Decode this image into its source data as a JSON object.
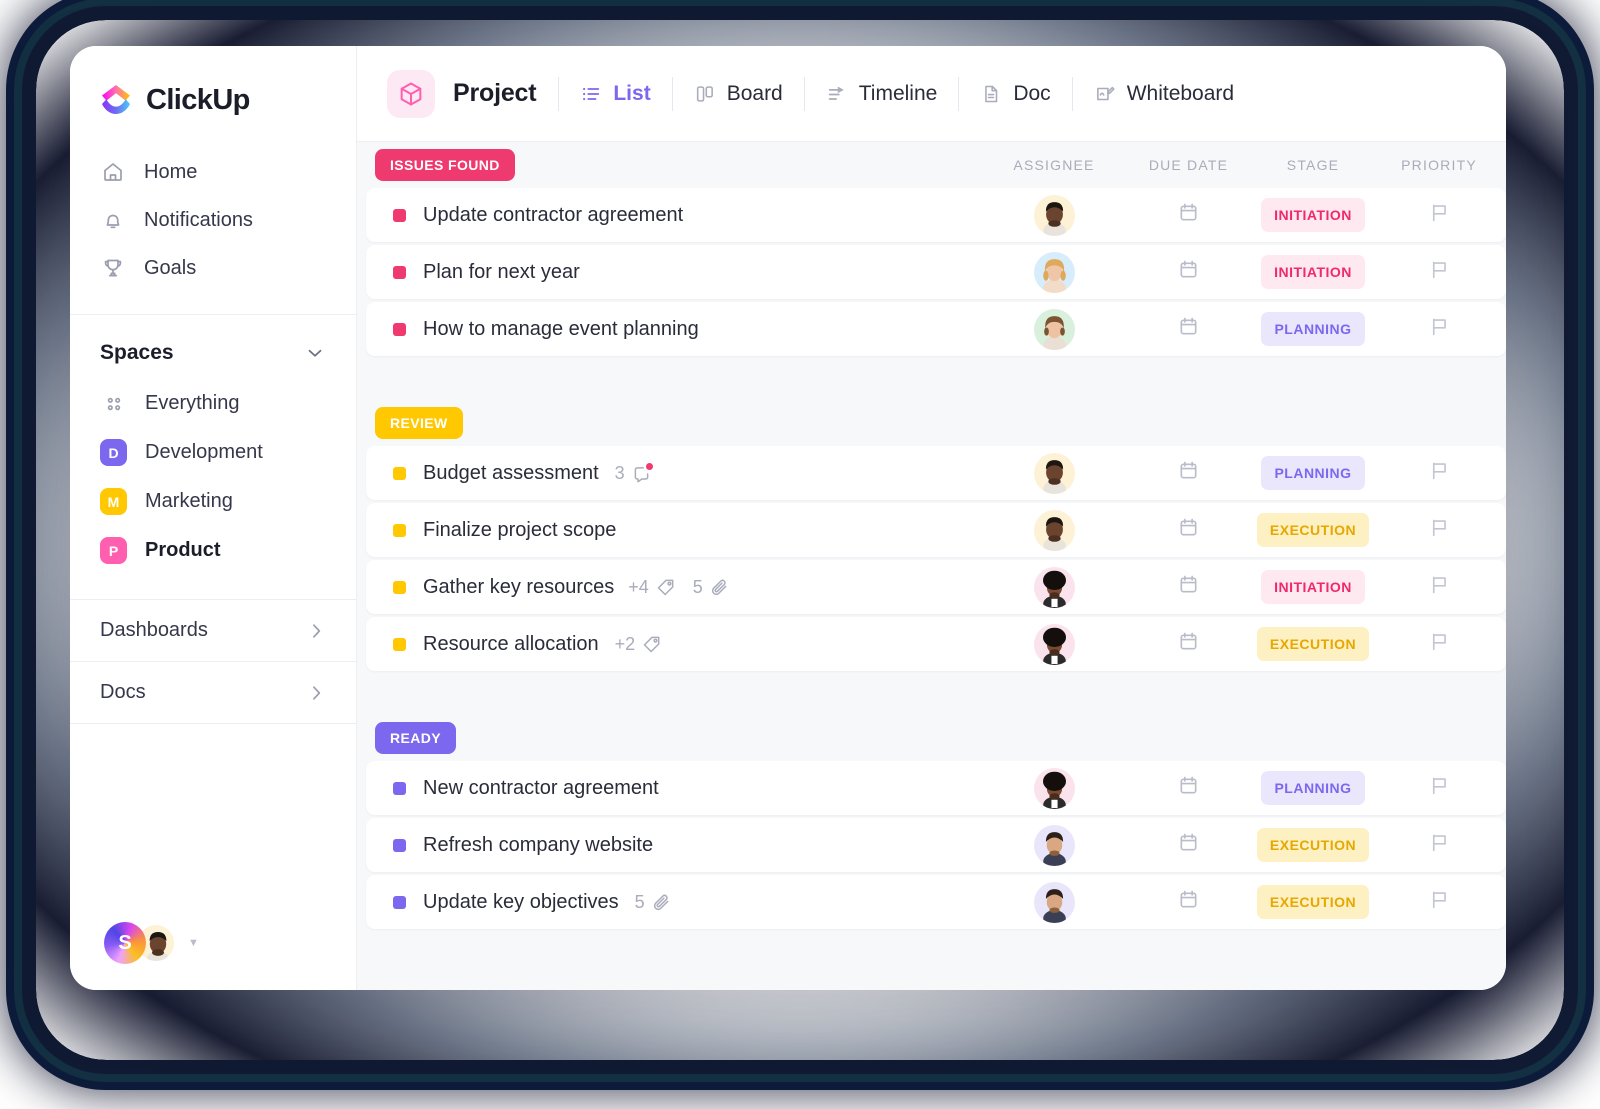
{
  "brand": {
    "name": "ClickUp",
    "logo_icon": "clickup-logo-icon"
  },
  "sidebar": {
    "nav": [
      {
        "label": "Home",
        "icon": "home-icon"
      },
      {
        "label": "Notifications",
        "icon": "bell-icon"
      },
      {
        "label": "Goals",
        "icon": "trophy-icon"
      }
    ],
    "spaces": {
      "title": "Spaces",
      "chevron_icon": "chevron-down-icon",
      "items": [
        {
          "label": "Everything",
          "icon": "grid-dots-icon",
          "chip": null,
          "color": null,
          "active": false
        },
        {
          "label": "Development",
          "chip": "D",
          "color": "#7b68ee",
          "active": false
        },
        {
          "label": "Marketing",
          "chip": "M",
          "color": "#ffc800",
          "active": false
        },
        {
          "label": "Product",
          "chip": "P",
          "color": "#ff5fae",
          "active": true
        }
      ]
    },
    "sections": [
      {
        "label": "Dashboards",
        "icon": "chevron-right-icon"
      },
      {
        "label": "Docs",
        "icon": "chevron-right-icon"
      }
    ],
    "footer": {
      "workspace_initial": "S",
      "avatar_icon": "user-avatar",
      "caret_icon": "caret-down-icon"
    }
  },
  "header": {
    "project_icon": "cube-icon",
    "title": "Project",
    "tabs": [
      {
        "label": "List",
        "icon": "list-icon",
        "active": true
      },
      {
        "label": "Board",
        "icon": "board-icon",
        "active": false
      },
      {
        "label": "Timeline",
        "icon": "timeline-icon",
        "active": false
      },
      {
        "label": "Doc",
        "icon": "doc-icon",
        "active": false
      },
      {
        "label": "Whiteboard",
        "icon": "whiteboard-icon",
        "active": false
      }
    ]
  },
  "columns": [
    "ASSIGNEE",
    "DUE DATE",
    "STAGE",
    "PRIORITY"
  ],
  "stage_colors": {
    "INITIATION": {
      "bg": "#ffe9f0",
      "fg": "#f0296b"
    },
    "PLANNING": {
      "bg": "#eae7fd",
      "fg": "#7b68ee"
    },
    "EXECUTION": {
      "bg": "#fdf0c2",
      "fg": "#e6a700"
    }
  },
  "groups": [
    {
      "label": "ISSUES FOUND",
      "color": "#ef3a6f",
      "bullet": "#ef3a6f",
      "show_columns": true,
      "tasks": [
        {
          "name": "Update contractor agreement",
          "comments": null,
          "tags": null,
          "attachments": null,
          "avatar": {
            "bg": "#fdf1d6",
            "skin": "#6b4430",
            "hair": "#1d1712",
            "shirt": "#e8e4dc"
          },
          "due_icon": "calendar-icon",
          "stage": "INITIATION",
          "priority_icon": "flag-icon"
        },
        {
          "name": "Plan for next year",
          "comments": null,
          "tags": null,
          "attachments": null,
          "avatar": {
            "bg": "#d8edfb",
            "skin": "#f0c6a8",
            "hair": "#e0a85a",
            "shirt": "#f2dcc8"
          },
          "due_icon": "calendar-icon",
          "stage": "INITIATION",
          "priority_icon": "flag-icon"
        },
        {
          "name": "How to manage event planning",
          "comments": null,
          "tags": null,
          "attachments": null,
          "avatar": {
            "bg": "#d9f0dd",
            "skin": "#eec2a2",
            "hair": "#7c5433",
            "shirt": "#eadfd4"
          },
          "due_icon": "calendar-icon",
          "stage": "PLANNING",
          "priority_icon": "flag-icon"
        }
      ]
    },
    {
      "label": "REVIEW",
      "color": "#ffc800",
      "bullet": "#ffc800",
      "show_columns": false,
      "tasks": [
        {
          "name": "Budget assessment",
          "comments": "3",
          "comments_icon": "comment-icon",
          "tags": null,
          "attachments": null,
          "avatar": {
            "bg": "#fdf1d6",
            "skin": "#6b4430",
            "hair": "#1d1712",
            "shirt": "#e8e4dc"
          },
          "due_icon": "calendar-icon",
          "stage": "PLANNING",
          "priority_icon": "flag-icon"
        },
        {
          "name": "Finalize project scope",
          "comments": null,
          "tags": null,
          "attachments": null,
          "avatar": {
            "bg": "#fdf1d6",
            "skin": "#6b4430",
            "hair": "#1d1712",
            "shirt": "#e8e4dc"
          },
          "due_icon": "calendar-icon",
          "stage": "EXECUTION",
          "priority_icon": "flag-icon"
        },
        {
          "name": "Gather key resources",
          "comments": null,
          "tags": "+4",
          "tags_icon": "tag-icon",
          "attachments": "5",
          "attachments_icon": "paperclip-icon",
          "avatar": {
            "bg": "#fbe3ee",
            "skin": "#7a4a32",
            "hair": "#140f0c",
            "shirt": "#2b2b2b"
          },
          "due_icon": "calendar-icon",
          "stage": "INITIATION",
          "priority_icon": "flag-icon"
        },
        {
          "name": "Resource allocation",
          "comments": null,
          "tags": "+2",
          "tags_icon": "tag-icon",
          "attachments": null,
          "avatar": {
            "bg": "#fbe3ee",
            "skin": "#7a4a32",
            "hair": "#140f0c",
            "shirt": "#2b2b2b"
          },
          "due_icon": "calendar-icon",
          "stage": "EXECUTION",
          "priority_icon": "flag-icon"
        }
      ]
    },
    {
      "label": "READY",
      "color": "#7b68ee",
      "bullet": "#7b68ee",
      "show_columns": false,
      "tasks": [
        {
          "name": "New contractor agreement",
          "comments": null,
          "tags": null,
          "attachments": null,
          "avatar": {
            "bg": "#fbe3ee",
            "skin": "#7a4a32",
            "hair": "#140f0c",
            "shirt": "#2b2b2b"
          },
          "due_icon": "calendar-icon",
          "stage": "PLANNING",
          "priority_icon": "flag-icon"
        },
        {
          "name": "Refresh company website",
          "comments": null,
          "tags": null,
          "attachments": null,
          "avatar": {
            "bg": "#e9e6fb",
            "skin": "#d9a882",
            "hair": "#2b211a",
            "shirt": "#3a3f55"
          },
          "due_icon": "calendar-icon",
          "stage": "EXECUTION",
          "priority_icon": "flag-icon"
        },
        {
          "name": "Update key objectives",
          "comments": null,
          "tags": null,
          "attachments": "5",
          "attachments_icon": "paperclip-icon",
          "avatar": {
            "bg": "#e9e6fb",
            "skin": "#d9a882",
            "hair": "#2b211a",
            "shirt": "#3a3f55"
          },
          "due_icon": "calendar-icon",
          "stage": "EXECUTION",
          "priority_icon": "flag-icon"
        }
      ]
    }
  ]
}
